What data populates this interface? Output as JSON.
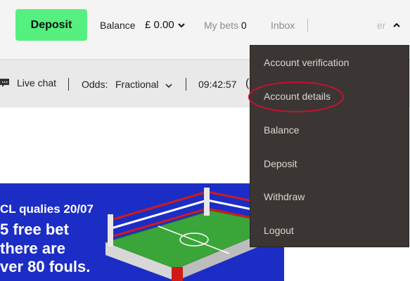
{
  "header": {
    "deposit_label": "Deposit",
    "balance_label": "Balance",
    "balance_value": "£ 0.00",
    "mybets_label": "My bets",
    "mybets_count": "0",
    "inbox_label": "Inbox",
    "account_label_partial": "er"
  },
  "subbar": {
    "livechat_label": "Live chat",
    "odds_label": "Odds:",
    "odds_value": "Fractional",
    "clock": "09:42:57",
    "clock_tail": "("
  },
  "banner": {
    "line1": "CL qualies 20/07",
    "line2": "5 free bet",
    "line3": " there are",
    "line4": "ver 80 fouls."
  },
  "account_menu": {
    "items": [
      {
        "label": "Account verification"
      },
      {
        "label": "Account details"
      },
      {
        "label": "Balance"
      },
      {
        "label": "Deposit"
      },
      {
        "label": "Withdraw"
      },
      {
        "label": "Logout"
      }
    ]
  },
  "colors": {
    "accent": "#55f07f",
    "menu_bg": "#3b3633",
    "banner_bg": "#1c2dc5",
    "highlight": "#c8102e"
  },
  "icons": [
    "chevron-down-icon",
    "chevron-up-icon",
    "chat-icon"
  ]
}
